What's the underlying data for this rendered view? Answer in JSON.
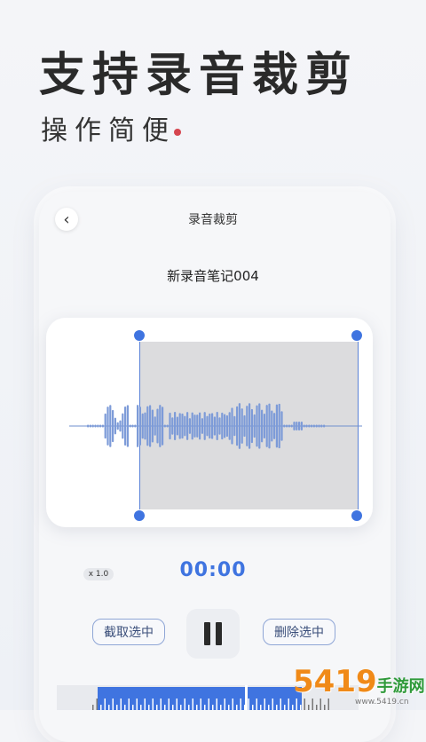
{
  "hero": {
    "title": "支持录音裁剪",
    "subtitle": "操作简便",
    "accent_color": "#d6454f"
  },
  "screen": {
    "title": "录音裁剪",
    "file_name": "新录音笔记004",
    "back_icon": "chevron-left-icon"
  },
  "player": {
    "speed": "x 1.0",
    "time": "00:00",
    "accent_color": "#3f74e0",
    "crop_label": "截取选中",
    "delete_label": "删除选中",
    "pause_icon": "pause-icon"
  },
  "watermark": {
    "brand": "5419",
    "brand_cn": "手游网",
    "url": "www.5419.cn"
  }
}
